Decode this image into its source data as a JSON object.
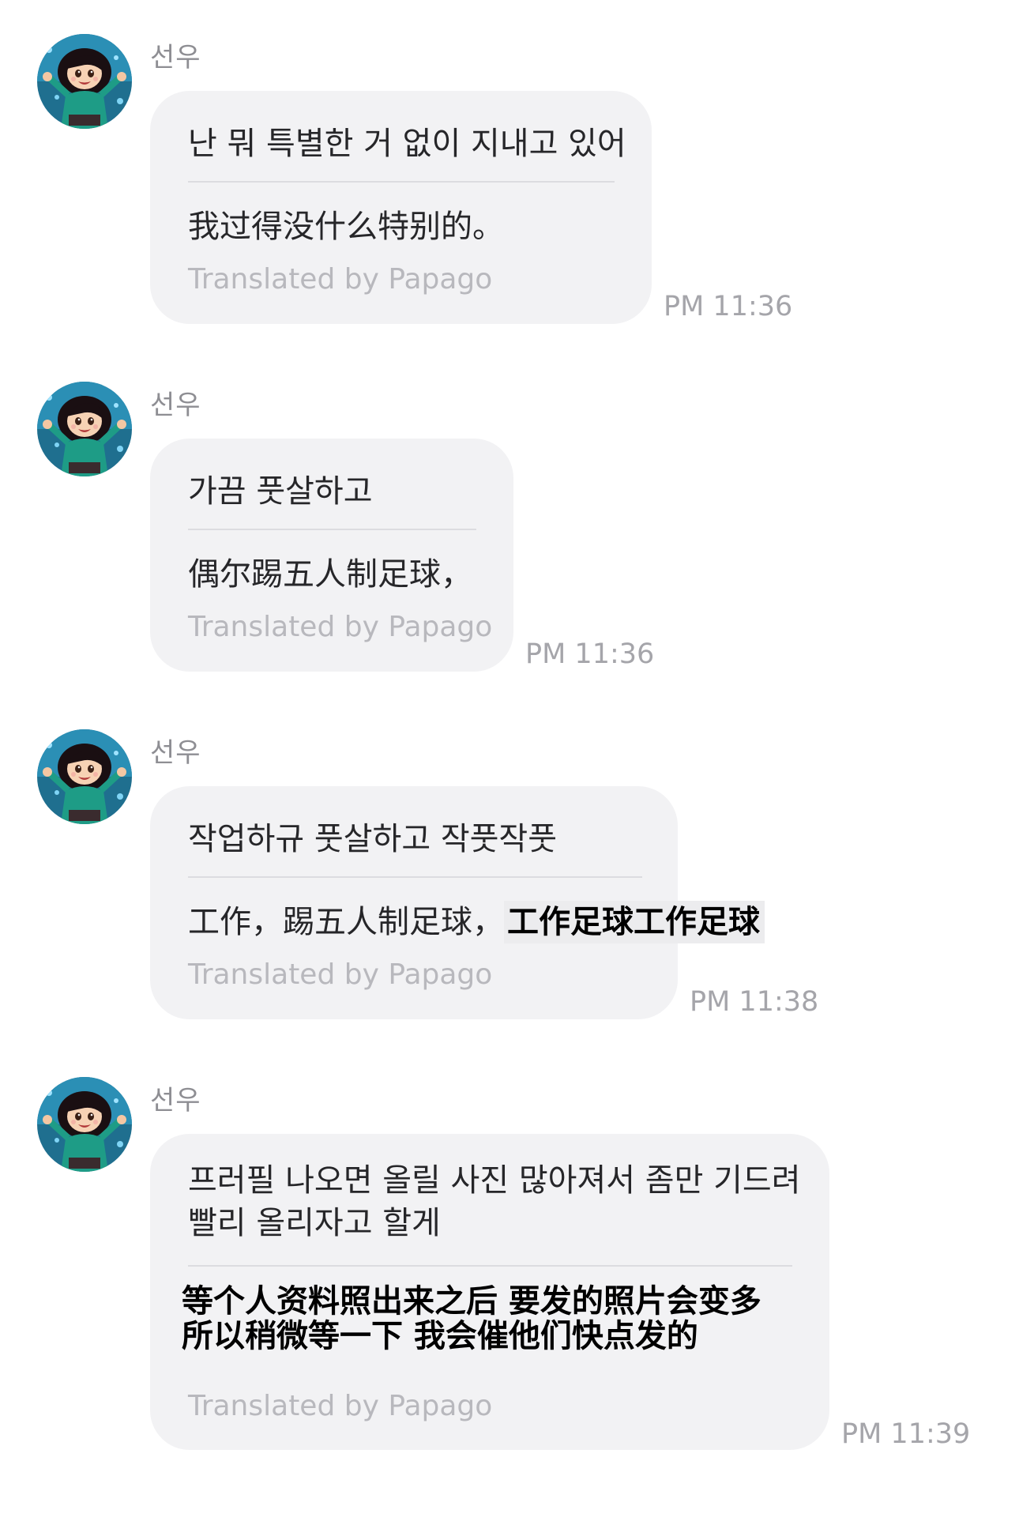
{
  "messages": [
    {
      "sender": "선우",
      "original": "난 뭐 특별한 거 없이 지내고 있어",
      "translation": "我过得没什么特别的。",
      "credit": "Translated by Papago",
      "time": "PM 11:36"
    },
    {
      "sender": "선우",
      "original": "가끔 풋살하고",
      "translation": "偶尔踢五人制足球，",
      "credit": "Translated by Papago",
      "time": "PM 11:36"
    },
    {
      "sender": "선우",
      "original": "작업하규 풋살하고 작풋작풋",
      "translation": "工作，踢五人制足球，",
      "translation_highlight": "工作足球工作足球",
      "credit": "Translated by Papago",
      "time": "PM 11:38"
    },
    {
      "sender": "선우",
      "original_line1": "프러필 나오면 올릴 사진 많아져서 좀만 기드려",
      "original_line2": "빨리 올리자고 할게",
      "translation_line1": "等个人资料照出来之后 要发的照片会变多",
      "translation_line2": "所以稍微等一下 我会催他们快点发的",
      "credit": "Translated by Papago",
      "time": "PM 11:39"
    }
  ],
  "colors": {
    "bubble": "#f2f2f4",
    "sender": "#8e8e93",
    "credit": "#b8b8bd",
    "time": "#a5a5aa"
  },
  "icons": {
    "avatar": "profile-avatar-cartoon-girl"
  }
}
